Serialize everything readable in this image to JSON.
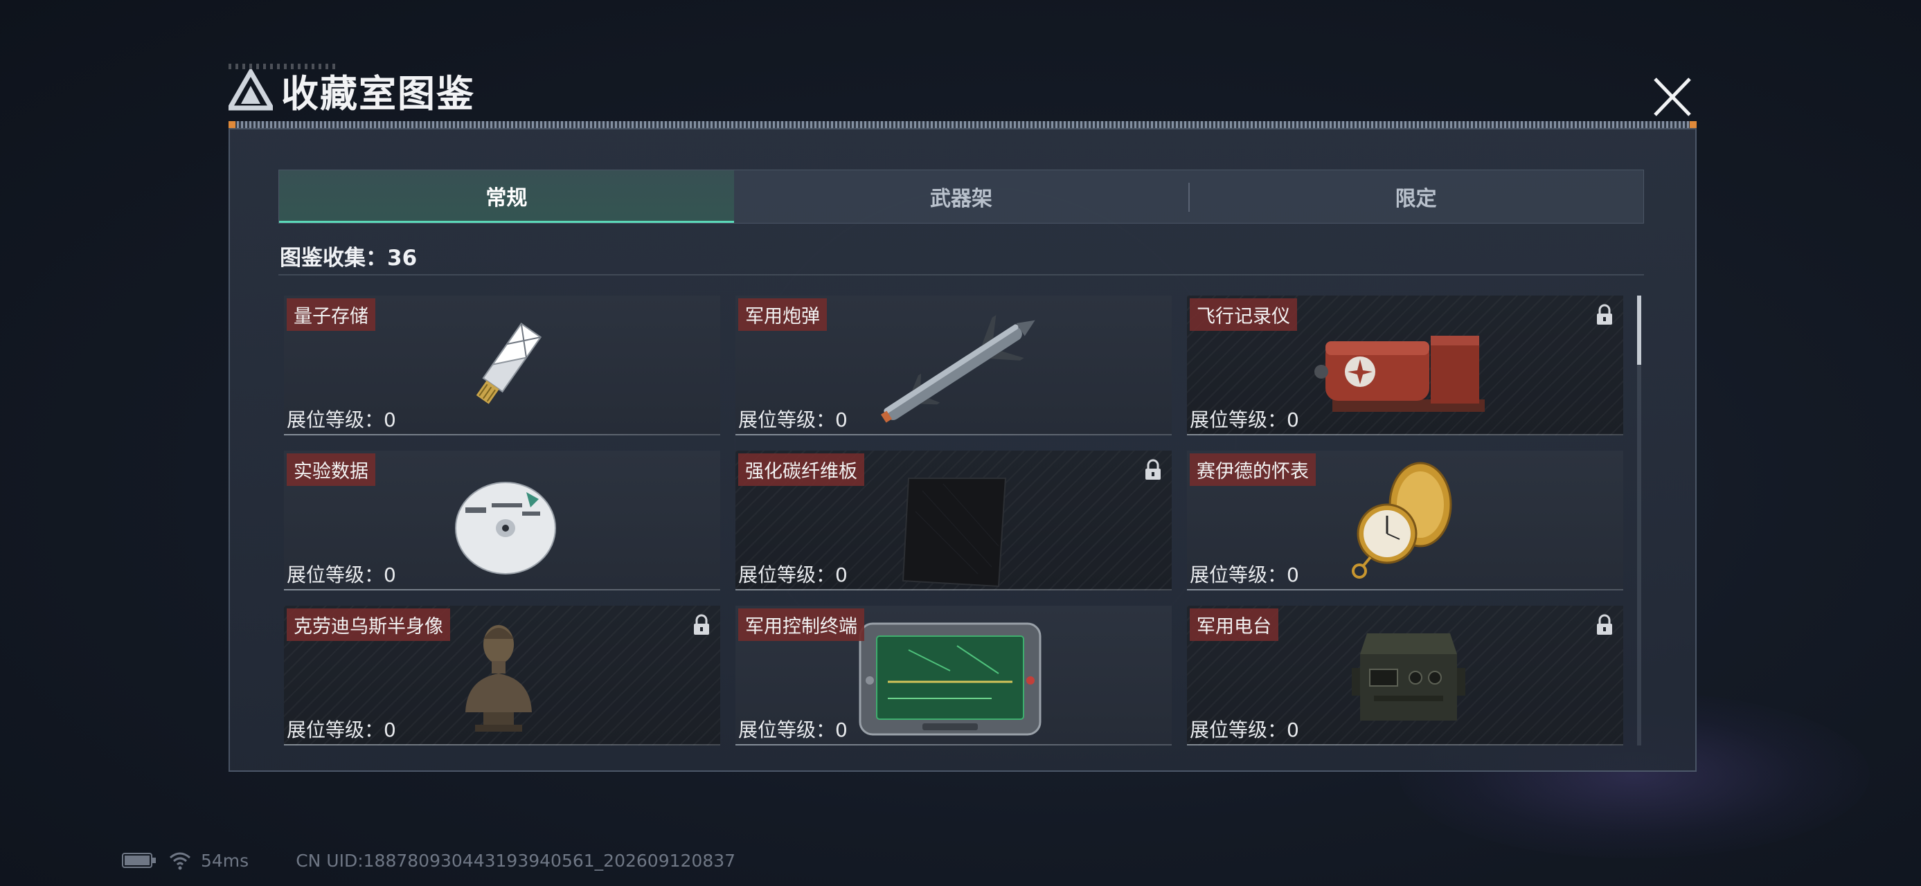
{
  "header": {
    "title": "收藏室图鉴"
  },
  "tabs": [
    {
      "label": "常规",
      "active": true
    },
    {
      "label": "武器架",
      "active": false
    },
    {
      "label": "限定",
      "active": false
    }
  ],
  "collection": {
    "label": "图鉴收集：36"
  },
  "items": [
    {
      "name": "量子存储",
      "level": "展位等级：0",
      "locked": false,
      "icon": "usb-drive-icon"
    },
    {
      "name": "军用炮弹",
      "level": "展位等级：0",
      "locked": false,
      "icon": "missile-icon"
    },
    {
      "name": "飞行记录仪",
      "level": "展位等级：0",
      "locked": true,
      "icon": "flight-recorder-icon"
    },
    {
      "name": "实验数据",
      "level": "展位等级：0",
      "locked": false,
      "icon": "disc-icon"
    },
    {
      "name": "强化碳纤维板",
      "level": "展位等级：0",
      "locked": true,
      "icon": "carbon-plate-icon"
    },
    {
      "name": "赛伊德的怀表",
      "level": "展位等级：0",
      "locked": false,
      "icon": "pocket-watch-icon"
    },
    {
      "name": "克劳迪乌斯半身像",
      "level": "展位等级：0",
      "locked": true,
      "icon": "bust-icon"
    },
    {
      "name": "军用控制终端",
      "level": "展位等级：0",
      "locked": false,
      "icon": "control-terminal-icon"
    },
    {
      "name": "军用电台",
      "level": "展位等级：0",
      "locked": true,
      "icon": "radio-icon"
    }
  ],
  "status": {
    "ping": "54ms",
    "uid": "CN UID:188780930443193940561_202609120837"
  },
  "colors": {
    "accent": "#5bd8b8",
    "name_tag": "#702c2c",
    "highlight": "#e08a3a"
  }
}
